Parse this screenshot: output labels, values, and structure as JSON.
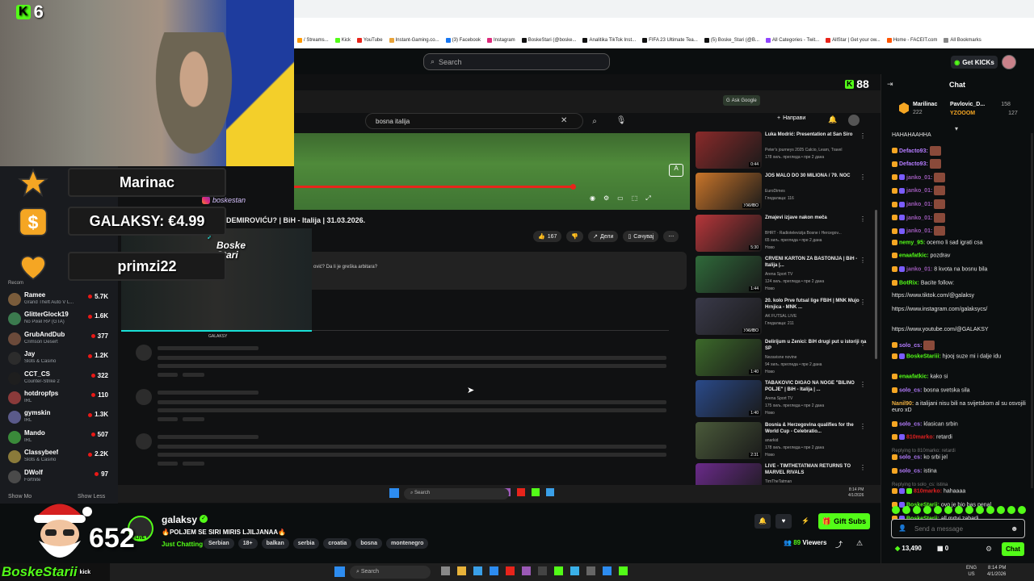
{
  "browser": {
    "bookmarks": [
      "/ Streams...",
      "Kick",
      "YouTube",
      "Instant-Gaming.co...",
      "(3) Facebook",
      "Instagram",
      "BoskeStari (@boske...",
      "Analitika TikTok Inst...",
      "FIFA 23 Ultimate Tea...",
      "(5) Boske_Stari (@B...",
      "All Categories - Twit...",
      "AllStar | Get your ow...",
      "Home - FACEIT.com",
      "All Bookmarks"
    ]
  },
  "kick": {
    "search_placeholder": "Search",
    "get_kicks": "Get KICKs",
    "k88": "88"
  },
  "overlay": {
    "k6": "6",
    "alerts": [
      {
        "text": "Marinac",
        "icon": "star-icon"
      },
      {
        "text": "GALAKSY: €4.99",
        "icon": "dollar-icon"
      },
      {
        "text": "primzi22",
        "icon": "heart-icon"
      }
    ],
    "instagram": "boskestan",
    "tiktok": "Boske\nStari",
    "second_cam_name": "GALAKSY",
    "count": "652",
    "logo": "BoskeStarii",
    "logo_kick": "kick"
  },
  "sidebar": {
    "heading": "Recom",
    "channels": [
      {
        "name": "Ramee",
        "game": "Grand Theft Auto V L...",
        "viewers": "5.7K",
        "color": "#7a5c3b"
      },
      {
        "name": "GlitterGlock19",
        "game": "No Pixel RP (GTA)",
        "viewers": "1.6K",
        "color": "#3b7a4e"
      },
      {
        "name": "GrubAndDub",
        "game": "Crimson Desert",
        "viewers": "377",
        "color": "#6b4a3a"
      },
      {
        "name": "Jay",
        "game": "Slots & Casino",
        "viewers": "1.2K",
        "color": "#2c2c2c"
      },
      {
        "name": "CCT_CS",
        "game": "Counter-Strike 2",
        "viewers": "322",
        "color": "#1e1e1e"
      },
      {
        "name": "hotdropfps",
        "game": "IRL",
        "viewers": "110",
        "color": "#8a3a3a"
      },
      {
        "name": "gymskin",
        "game": "IRL",
        "viewers": "1.3K",
        "color": "#5a5a8a"
      },
      {
        "name": "Mando",
        "game": "IRL",
        "viewers": "507",
        "color": "#3a8a3a"
      },
      {
        "name": "Classybeef",
        "game": "Slots & Casino",
        "viewers": "2.2K",
        "color": "#8a7a3a"
      },
      {
        "name": "DWolf",
        "game": "Fortnite",
        "viewers": "97",
        "color": "#4a4a4a"
      }
    ],
    "show_more": "Show Mo",
    "show_less": "Show Less"
  },
  "youtube": {
    "search_value": "bosna italija",
    "ask_google": "Ask Google",
    "create": "Направи",
    "title": "DEMIROVIĆU? | BiH - Italija | 31.03.2026.",
    "likes": "167",
    "share": "Дели",
    "save": "Сачувај",
    "desc": "ović? Da li je greška arbitara?",
    "recommended": [
      {
        "title": "Luka Modrić: Presentation at San Siro",
        "channel": "Peter's journeys 2025 Calcio, Learn, Travel",
        "meta": "178 хиљ. прегледа • пре 2 дана",
        "meta2": "",
        "color": "#8a2a2a",
        "duration": "0:44"
      },
      {
        "title": "JOŠ MALO DO 30 MILIONA / 79. NOĆ",
        "channel": "EuroDimes",
        "meta": "Гледалаца: 116",
        "meta2": "",
        "color": "#c9752a",
        "duration": "УЖИВО"
      },
      {
        "title": "Zmajevi izjave nakon meča",
        "channel": "BHRT - Radiotelevizija Bosne i Hercegov...",
        "meta": "65 хиљ. прегледа • пре 2 дана",
        "meta2": "Ново",
        "color": "#b7363a",
        "duration": "5:30"
      },
      {
        "title": "CRVENI KARTON ZA BASTONIJA | BiH - Italija |...",
        "channel": "Arena Sport TV",
        "meta": "124 хиљ. прегледа • пре 2 дана",
        "meta2": "Ново",
        "color": "#2f6a3a",
        "duration": "1:44"
      },
      {
        "title": "20. kolo Prve futsal lige FBiH | MNK Mujo Hrnjica - MNK ...",
        "channel": "AK FUTSAL LIVE",
        "meta": "Гледалаца: 211",
        "meta2": "",
        "color": "#3a3a4a",
        "duration": "УЖИВО"
      },
      {
        "title": "Delirijum u Zenici: BiH drugi put u istoriji na SP",
        "channel": "Nezavisne novine",
        "meta": "94 хиљ. прегледа • пре 2 дана",
        "meta2": "Ново",
        "color": "#3c6a2a",
        "duration": "1:40"
      },
      {
        "title": "TABAKOVIĆ DIGAO NA NOGE \"BILINO POLJE\" | BiH - Italija | ...",
        "channel": "Arena Sport TV",
        "meta": "175 хиљ. прегледа • пре 2 дана",
        "meta2": "Ново",
        "color": "#2a4a8a",
        "duration": "1:40"
      },
      {
        "title": "Bosnia & Herzegovina qualifies for the World Cup - Celebratio...",
        "channel": "anarkid",
        "meta": "178 хиљ. прегледа • пре 2 дана",
        "meta2": "Ново",
        "color": "#4a5a3a",
        "duration": "2:31"
      },
      {
        "title": "LIVE - TIMTHETATMAN RETURNS TO MARVEL RIVALS",
        "channel": "TimTheTatman",
        "meta": "",
        "meta2": "",
        "color": "#6a2a8a",
        "duration": ""
      }
    ],
    "taskbar_search": "Search",
    "taskbar_time": "8:14 PM",
    "taskbar_date": "4/1/2026"
  },
  "stream": {
    "streamer": "galaksy",
    "title": "🔥POLJEM SE SIRI MIRIS LJILJANAA🔥",
    "category": "Just Chatting",
    "tags": [
      "Serbian",
      "18+",
      "balkan",
      "serbia",
      "croatia",
      "bosna",
      "montenegro"
    ],
    "gift_subs": "Gift Subs",
    "viewers": "89",
    "viewers_label": "Viewers",
    "live_badge": "LIVE"
  },
  "chat": {
    "title": "Chat",
    "leaderboard": [
      {
        "name": "Marilinac",
        "count": "222"
      },
      {
        "name": "Pavlovic_D...",
        "count": "158"
      },
      {
        "name": "YZOOOM",
        "count": "127"
      }
    ],
    "messages": [
      {
        "user": "",
        "text": "HAHAHAAHHA",
        "color": "#e6e6e6",
        "reply": "",
        "badges": 0
      },
      {
        "user": "Defacto93:",
        "text": "",
        "color": "#b57cff",
        "reply": "",
        "badges": 1
      },
      {
        "user": "Defacto93:",
        "text": "",
        "color": "#b57cff",
        "reply": "",
        "badges": 1
      },
      {
        "user": "janko_01:",
        "text": "",
        "color": "#9b59b6",
        "reply": "",
        "badges": 2
      },
      {
        "user": "janko_01:",
        "text": "",
        "color": "#9b59b6",
        "reply": "",
        "badges": 2
      },
      {
        "user": "janko_01:",
        "text": "",
        "color": "#9b59b6",
        "reply": "",
        "badges": 2
      },
      {
        "user": "janko_01:",
        "text": "",
        "color": "#9b59b6",
        "reply": "",
        "badges": 2
      },
      {
        "user": "janko_01:",
        "text": "",
        "color": "#9b59b6",
        "reply": "",
        "badges": 2
      },
      {
        "user": "nemy_95:",
        "text": "ocemo li sad igrati csa",
        "color": "#53fc18",
        "reply": "",
        "badges": 1
      },
      {
        "user": "enaafatkic:",
        "text": "pozdrav",
        "color": "#53fc18",
        "reply": "",
        "badges": 1
      },
      {
        "user": "janko_01:",
        "text": "8 kvota na bosnu bila",
        "color": "#9b59b6",
        "reply": "",
        "badges": 2
      },
      {
        "user": "BotRix:",
        "text": "Bacite follow:",
        "color": "#53fc18",
        "reply": "",
        "badges": 1
      },
      {
        "user": "",
        "text": "https://www.tiktok.com/@galaksy",
        "color": "#e6e6e6",
        "reply": "",
        "badges": 0
      },
      {
        "user": "",
        "text": "https://www.instagram.com/galaksycs/",
        "color": "#e6e6e6",
        "reply": "",
        "badges": 0
      },
      {
        "user": "",
        "text": "https://www.youtube.com/@GALAKSY",
        "color": "#e6e6e6",
        "reply": "",
        "badges": 0
      },
      {
        "user": "solo_cs:",
        "text": "",
        "color": "#b57cff",
        "reply": "",
        "badges": 1
      },
      {
        "user": "BoskeStariii:",
        "text": "hjooj suze mi i dalje idu",
        "color": "#53fc18",
        "reply": "",
        "badges": 2
      },
      {
        "user": "enaafatkic:",
        "text": "kako si",
        "color": "#53fc18",
        "reply": "",
        "badges": 1
      },
      {
        "user": "solo_cs:",
        "text": "bosna svetska sila",
        "color": "#b57cff",
        "reply": "",
        "badges": 1
      },
      {
        "user": "Nanil90:",
        "text": "a italijani nisu bili na svijetskom al su osvojili euro xD",
        "color": "#f0b040",
        "reply": "",
        "badges": 0
      },
      {
        "user": "solo_cs:",
        "text": "klasican srbin",
        "color": "#b57cff",
        "reply": "",
        "badges": 1
      },
      {
        "user": "810marko:",
        "text": "retardi",
        "color": "#e02020",
        "reply": "",
        "badges": 2
      },
      {
        "user": "solo_cs:",
        "text": "ko srbi jel",
        "color": "#b57cff",
        "reply": "Replying to 810marko: retardi",
        "badges": 1
      },
      {
        "user": "solo_cs:",
        "text": "istina",
        "color": "#b57cff",
        "reply": "",
        "badges": 1
      },
      {
        "user": "810marko:",
        "text": "hahaaaa",
        "color": "#e02020",
        "reply": "Replying to solo_cs: istina",
        "badges": 3
      },
      {
        "user": "BoskeStarii:",
        "text": "ovo je bio bas penal",
        "color": "#53fc18",
        "reply": "",
        "badges": 2
      },
      {
        "user": "BoskeStarii:",
        "text": "all mrtvi zabarli",
        "color": "#53fc18",
        "reply": "",
        "badges": 2
      }
    ],
    "input_placeholder": "Send a message",
    "kicks_balance": "13,490",
    "subs": "0",
    "send": "Chat"
  },
  "windows": {
    "search": "Search",
    "lang": "ENG\nUS",
    "time": "8:14 PM",
    "date": "4/1/2026"
  },
  "colors": {
    "kick_green": "#53fc18",
    "yt_red": "#e8241b"
  }
}
